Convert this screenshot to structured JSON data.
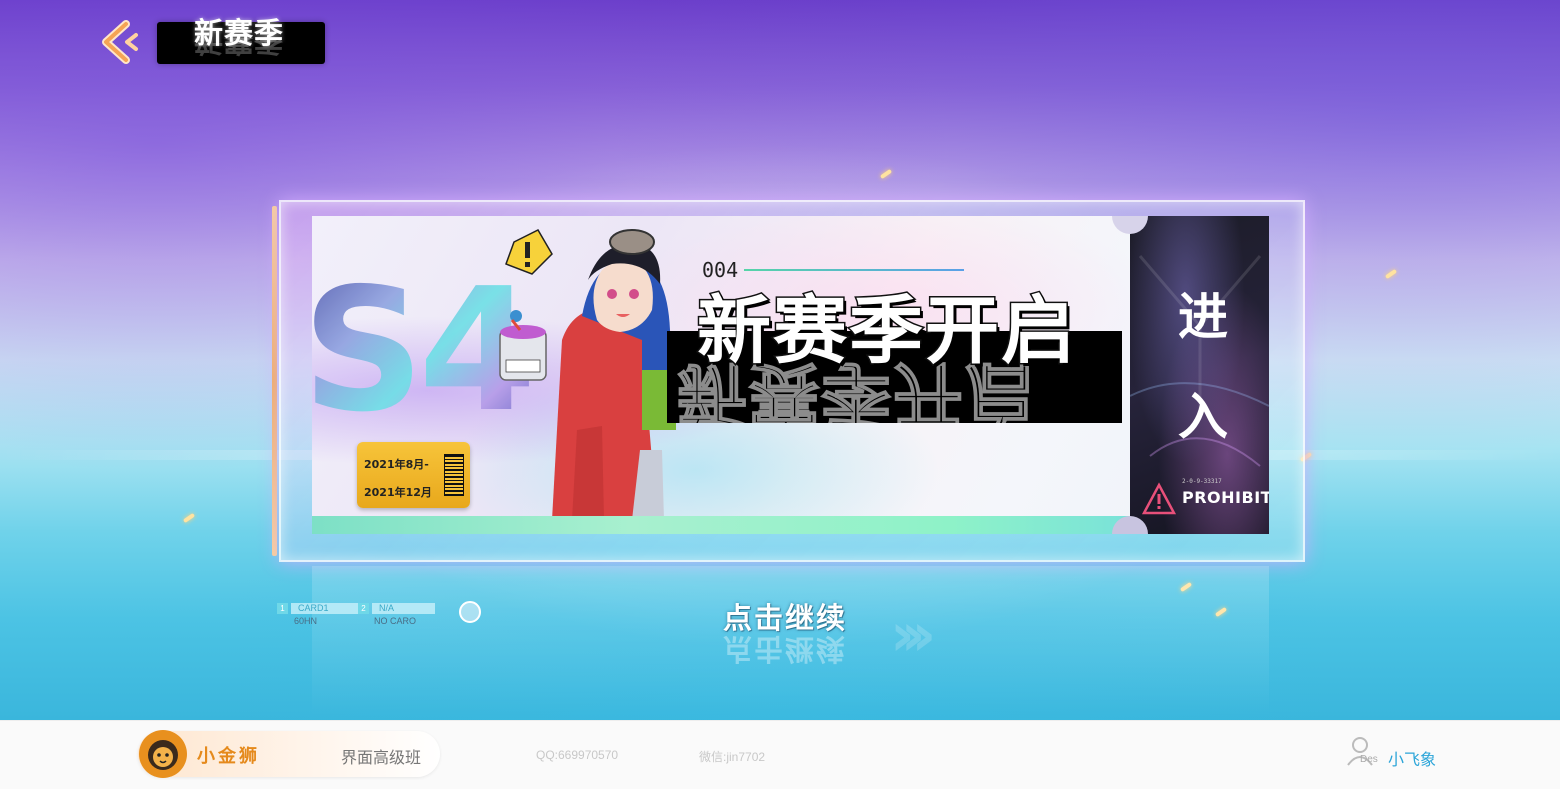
{
  "header": {
    "back_icon": "chevron-left-icon",
    "title": "新赛季"
  },
  "card": {
    "season": "S4",
    "number": "004",
    "heading": "新赛季开启",
    "date_start": "2021年8月-",
    "date_end": "2021年12月",
    "stub_chars": [
      "进",
      "入"
    ],
    "brand": "PROHIBIT",
    "brand_code": "2-0-9-33317"
  },
  "hud": {
    "slot1_index": "1",
    "slot1_label": "CARD1",
    "slot1_sub": "60HN",
    "slot2_index": "2",
    "slot2_label": "N/A",
    "slot2_sub": "NO CARO"
  },
  "continue_label": "点击继续",
  "footer": {
    "brand_name": "小金狮",
    "course": "界面高级班",
    "qq": "QQ:669970570",
    "wechat": "微信:jin7702",
    "user_tag": "Des",
    "user_name": "小飞象"
  },
  "colors": {
    "accent_gold": "#f6b04e",
    "badge_yellow": "#f7c43a",
    "brand_orange": "#e58a1c",
    "user_blue": "#2aa4d8"
  }
}
